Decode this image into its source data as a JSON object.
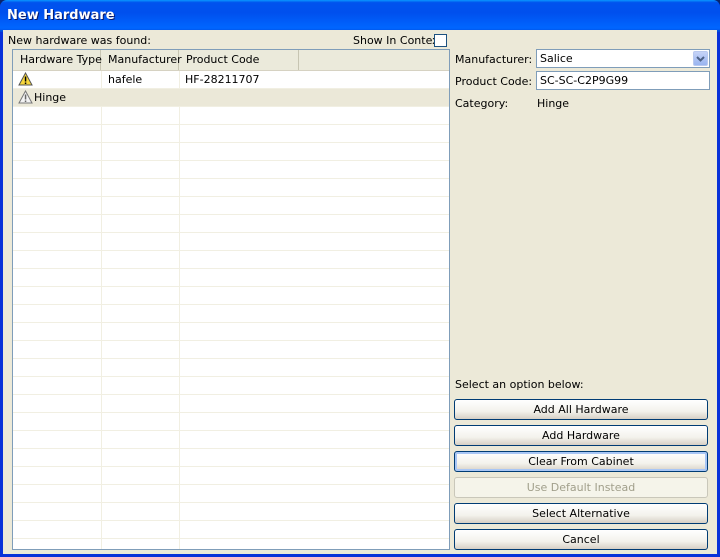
{
  "window": {
    "title": "New Hardware"
  },
  "left": {
    "found_label": "New hardware was found:",
    "show_in_context_label": "Show In Context",
    "columns": [
      "Hardware Type",
      "Manufacturer",
      "Product Code"
    ],
    "rows": [
      {
        "type": "",
        "manufacturer": "hafele",
        "product_code": "HF-28211707",
        "icon": "warning-icon"
      },
      {
        "type": "Hinge",
        "manufacturer": "",
        "product_code": "",
        "icon": "warning-outline-icon"
      }
    ]
  },
  "right": {
    "manufacturer_label": "Manufacturer:",
    "manufacturer_value": "Salice",
    "product_code_label": "Product Code:",
    "product_code_value": "SC-SC-C2P9G99",
    "category_label": "Category:",
    "category_value": "Hinge",
    "options_label": "Select an option below:",
    "buttons": {
      "add_all": "Add All Hardware",
      "add": "Add Hardware",
      "clear": "Clear From Cabinet",
      "default": "Use Default Instead",
      "alternative": "Select Alternative",
      "cancel": "Cancel"
    }
  },
  "colors": {
    "titlebar": "#0055e5",
    "face": "#ece9d8",
    "warning": "#f4d03f"
  }
}
